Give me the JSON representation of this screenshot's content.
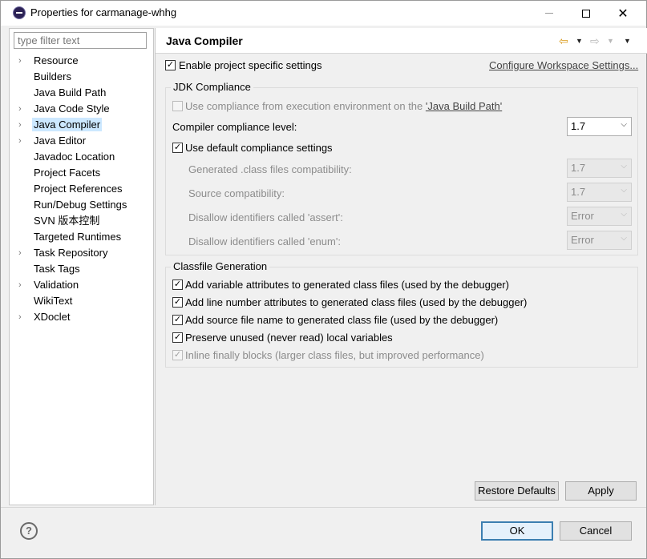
{
  "window": {
    "title": "Properties for carmanage-whhg",
    "icon": "eclipse-icon",
    "close_glyph": "✕"
  },
  "filter": {
    "placeholder": "type filter text"
  },
  "tree": {
    "items": [
      {
        "label": "Resource",
        "expandable": true,
        "selected": false
      },
      {
        "label": "Builders",
        "expandable": false,
        "selected": false
      },
      {
        "label": "Java Build Path",
        "expandable": false,
        "selected": false
      },
      {
        "label": "Java Code Style",
        "expandable": true,
        "selected": false
      },
      {
        "label": "Java Compiler",
        "expandable": true,
        "selected": true
      },
      {
        "label": "Java Editor",
        "expandable": true,
        "selected": false
      },
      {
        "label": "Javadoc Location",
        "expandable": false,
        "selected": false
      },
      {
        "label": "Project Facets",
        "expandable": false,
        "selected": false
      },
      {
        "label": "Project References",
        "expandable": false,
        "selected": false
      },
      {
        "label": "Run/Debug Settings",
        "expandable": false,
        "selected": false
      },
      {
        "label": "SVN 版本控制",
        "expandable": false,
        "selected": false
      },
      {
        "label": "Targeted Runtimes",
        "expandable": false,
        "selected": false
      },
      {
        "label": "Task Repository",
        "expandable": true,
        "selected": false
      },
      {
        "label": "Task Tags",
        "expandable": false,
        "selected": false
      },
      {
        "label": "Validation",
        "expandable": true,
        "selected": false
      },
      {
        "label": "WikiText",
        "expandable": false,
        "selected": false
      },
      {
        "label": "XDoclet",
        "expandable": true,
        "selected": false
      }
    ]
  },
  "page": {
    "title": "Java Compiler",
    "enable_project_specific": {
      "label": "Enable project specific settings",
      "checked": true
    },
    "configure_link": "Configure Workspace Settings...",
    "jdk": {
      "group_title": "JDK Compliance",
      "use_compliance_prefix": "Use compliance from execution environment on the ",
      "use_compliance_link": "'Java Build Path'",
      "use_compliance_checked": false,
      "compliance_level_label": "Compiler compliance level:",
      "compliance_level_value": "1.7",
      "use_default_label": "Use default compliance settings",
      "use_default_checked": true,
      "generated_label": "Generated .class files compatibility:",
      "generated_value": "1.7",
      "source_label": "Source compatibility:",
      "source_value": "1.7",
      "assert_label": "Disallow identifiers called 'assert':",
      "assert_value": "Error",
      "enum_label": "Disallow identifiers called 'enum':",
      "enum_value": "Error"
    },
    "classfile": {
      "group_title": "Classfile Generation",
      "options": [
        {
          "label": "Add variable attributes to generated class files (used by the debugger)",
          "checked": true,
          "enabled": true
        },
        {
          "label": "Add line number attributes to generated class files (used by the debugger)",
          "checked": true,
          "enabled": true
        },
        {
          "label": "Add source file name to generated class file (used by the debugger)",
          "checked": true,
          "enabled": true
        },
        {
          "label": "Preserve unused (never read) local variables",
          "checked": true,
          "enabled": true
        },
        {
          "label": "Inline finally blocks (larger class files, but improved performance)",
          "checked": true,
          "enabled": false
        }
      ]
    },
    "restore_defaults": "Restore Defaults",
    "apply": "Apply"
  },
  "footer": {
    "help_glyph": "?",
    "ok": "OK",
    "cancel": "Cancel"
  },
  "colors": {
    "selection": "#cce8ff",
    "default_button_border": "#3c7fb1",
    "nav_back": "#d99a1a"
  }
}
